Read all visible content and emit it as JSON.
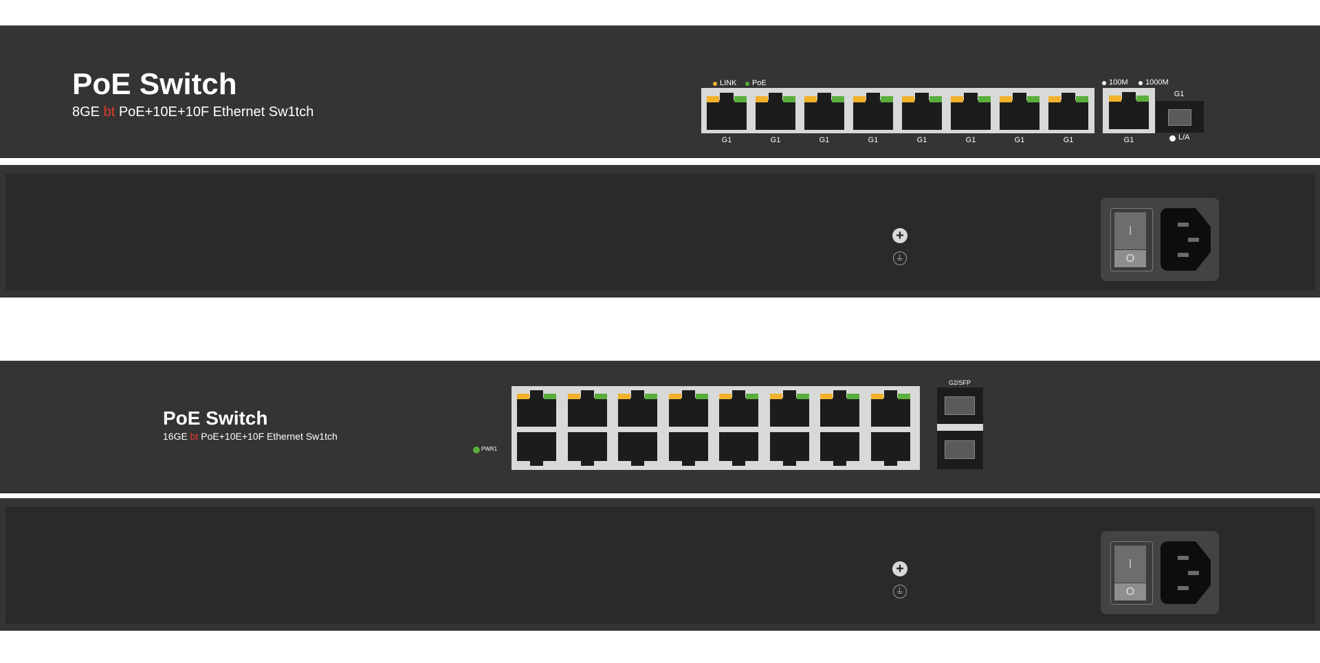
{
  "device_1": {
    "title": "PoE Switch",
    "subtitle_pre": "8GE ",
    "subtitle_red": "bt",
    "subtitle_post": " PoE+10E+10F Ethernet Sw1tch",
    "legend_link": "LINK",
    "legend_poe": "PoE",
    "legend_100m": "100M",
    "legend_1000m": "1000M",
    "port_labels": [
      "G1",
      "G1",
      "G1",
      "G1",
      "G1",
      "G1",
      "G1",
      "G1"
    ],
    "uplink_label": "G1",
    "sfp_label": "G1",
    "sfp_led_label": "L/A"
  },
  "device_2": {
    "title": "PoE Switch",
    "subtitle_pre": "16GE ",
    "subtitle_red": "bt",
    "subtitle_post": " PoE+10E+10F Ethernet Sw1tch",
    "pwr_label": "PWR1",
    "sfp_label": "G2/SFP"
  },
  "rear": {
    "screw_symbol": "+",
    "switch_on": "I",
    "switch_off": "O"
  },
  "colors": {
    "panel": "#363433",
    "led_yellow": "#f2b22c",
    "led_green": "#5aae3c",
    "accent_red": "#e03b2f"
  }
}
